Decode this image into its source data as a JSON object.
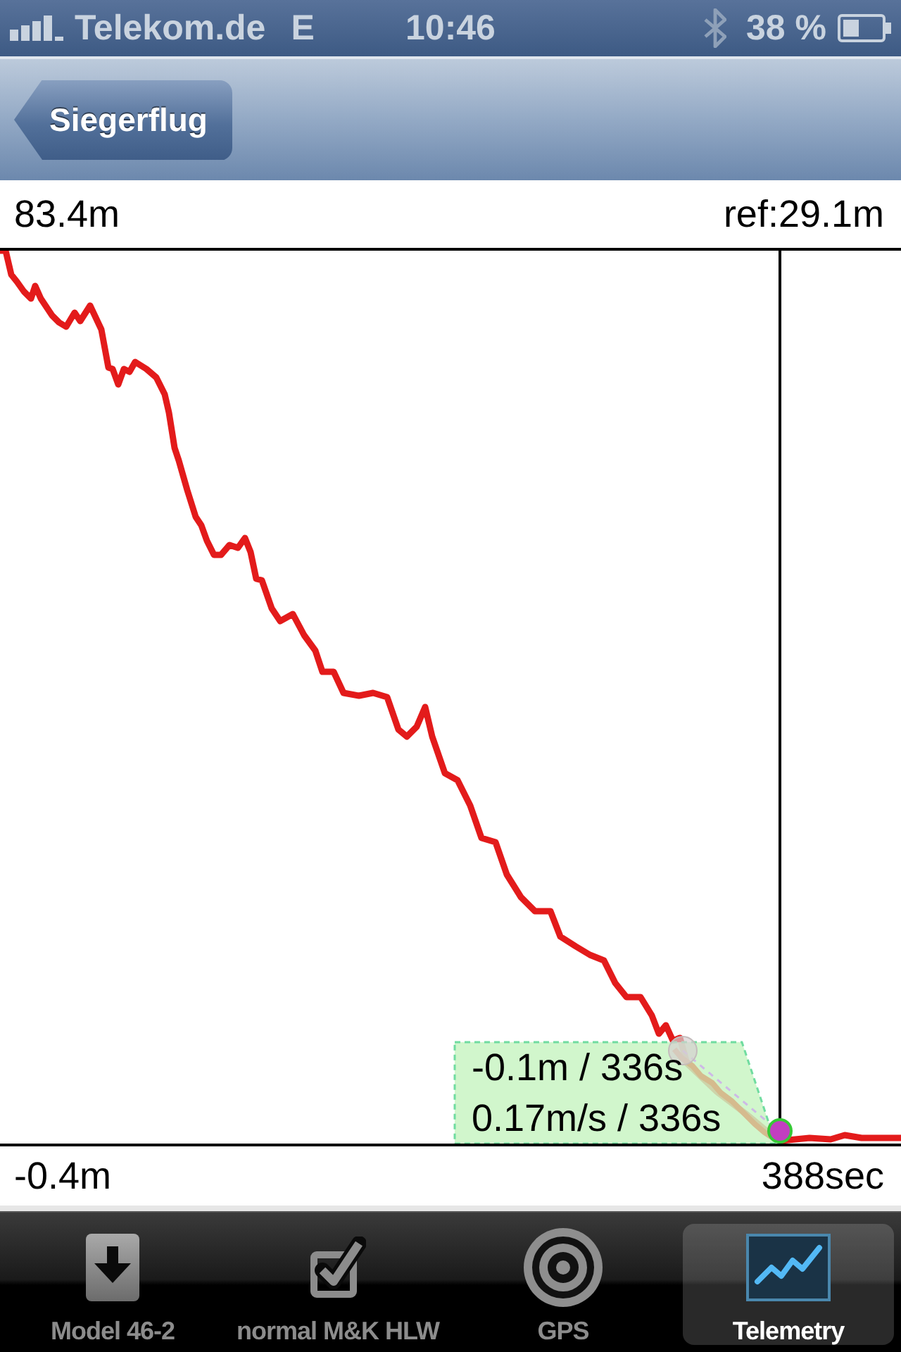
{
  "status_bar": {
    "carrier": "Telekom.de",
    "network": "E",
    "time": "10:46",
    "battery": "38 %"
  },
  "nav_bar": {
    "back_button": "Siegerflug"
  },
  "telemetry": {
    "max_label": "83.4m",
    "ref_label": "ref:29.1m",
    "readout": [
      "-0.1m / 336s",
      "0.17m/s / 336s"
    ],
    "min_label": "-0.4m",
    "time_label": "388sec"
  },
  "tab_bar": {
    "tabs": [
      {
        "label": "Model 46-2",
        "selected": false
      },
      {
        "label": "normal M&K HLW",
        "selected": false
      },
      {
        "label": "GPS",
        "selected": false
      },
      {
        "label": "Telemetry",
        "selected": true
      }
    ]
  }
}
